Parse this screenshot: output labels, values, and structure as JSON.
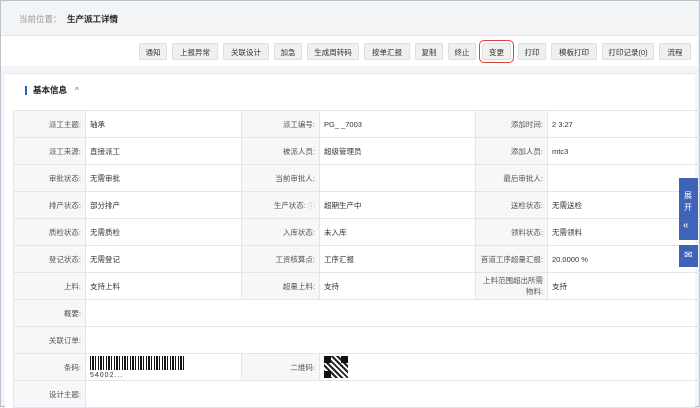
{
  "breadcrumb": {
    "label": "当前位置：",
    "page": "生产派工详情"
  },
  "toolbar": {
    "buttons": [
      {
        "label": "通知"
      },
      {
        "label": "上报异常"
      },
      {
        "label": "关联设计"
      },
      {
        "label": "加急"
      },
      {
        "label": "生成周转码"
      },
      {
        "label": "按单汇报"
      },
      {
        "label": "复制"
      },
      {
        "label": "终止"
      },
      {
        "label": "变更"
      },
      {
        "label": "打印"
      },
      {
        "label": "模板打印"
      },
      {
        "label": "打印记录(0)"
      },
      {
        "label": "流程"
      }
    ]
  },
  "section": {
    "title": "基本信息",
    "chevron": "^"
  },
  "rows": [
    [
      [
        "派工主题:",
        "轴承"
      ],
      [
        "派工编号:",
        "PG_           _7003"
      ],
      [
        "添加时间:",
        "2                  3:27"
      ]
    ],
    [
      [
        "派工来源:",
        "直接派工"
      ],
      [
        "被派人员:",
        "超级管理员"
      ],
      [
        "添加人员:",
        "mtc3"
      ]
    ],
    [
      [
        "审批状态:",
        "无需审批"
      ],
      [
        "当前审批人:",
        ""
      ],
      [
        "最后审批人:",
        ""
      ]
    ],
    [
      [
        "排产状态:",
        "部分排产"
      ],
      [
        "生产状态:",
        "超期生产中"
      ],
      [
        "送检状态:",
        "无需送检"
      ]
    ],
    [
      [
        "质检状态:",
        "无需质检"
      ],
      [
        "入库状态:",
        "未入库"
      ],
      [
        "领料状态:",
        "无需领料"
      ]
    ],
    [
      [
        "登记状态:",
        "无需登记"
      ],
      [
        "工资核算点:",
        "工序汇报"
      ],
      [
        "首道工序超量汇报:",
        "20.0000 %"
      ]
    ],
    [
      [
        "上料:",
        "支持上料"
      ],
      [
        "超量上料:",
        "支持"
      ],
      [
        "上料范围超出所需物料:",
        "支持"
      ]
    ]
  ],
  "wide_rows": [
    {
      "label": "概要:",
      "value": ""
    },
    {
      "label": "关联订单:",
      "value": ""
    }
  ],
  "code_row": {
    "barcode_label": "条码:",
    "barcode_number": "54002...",
    "qrcode_label": "二维码:"
  },
  "design_row": {
    "label": "设计主题:",
    "value": ""
  },
  "side_panel": {
    "expand_label": "展开",
    "chevron": "«"
  }
}
